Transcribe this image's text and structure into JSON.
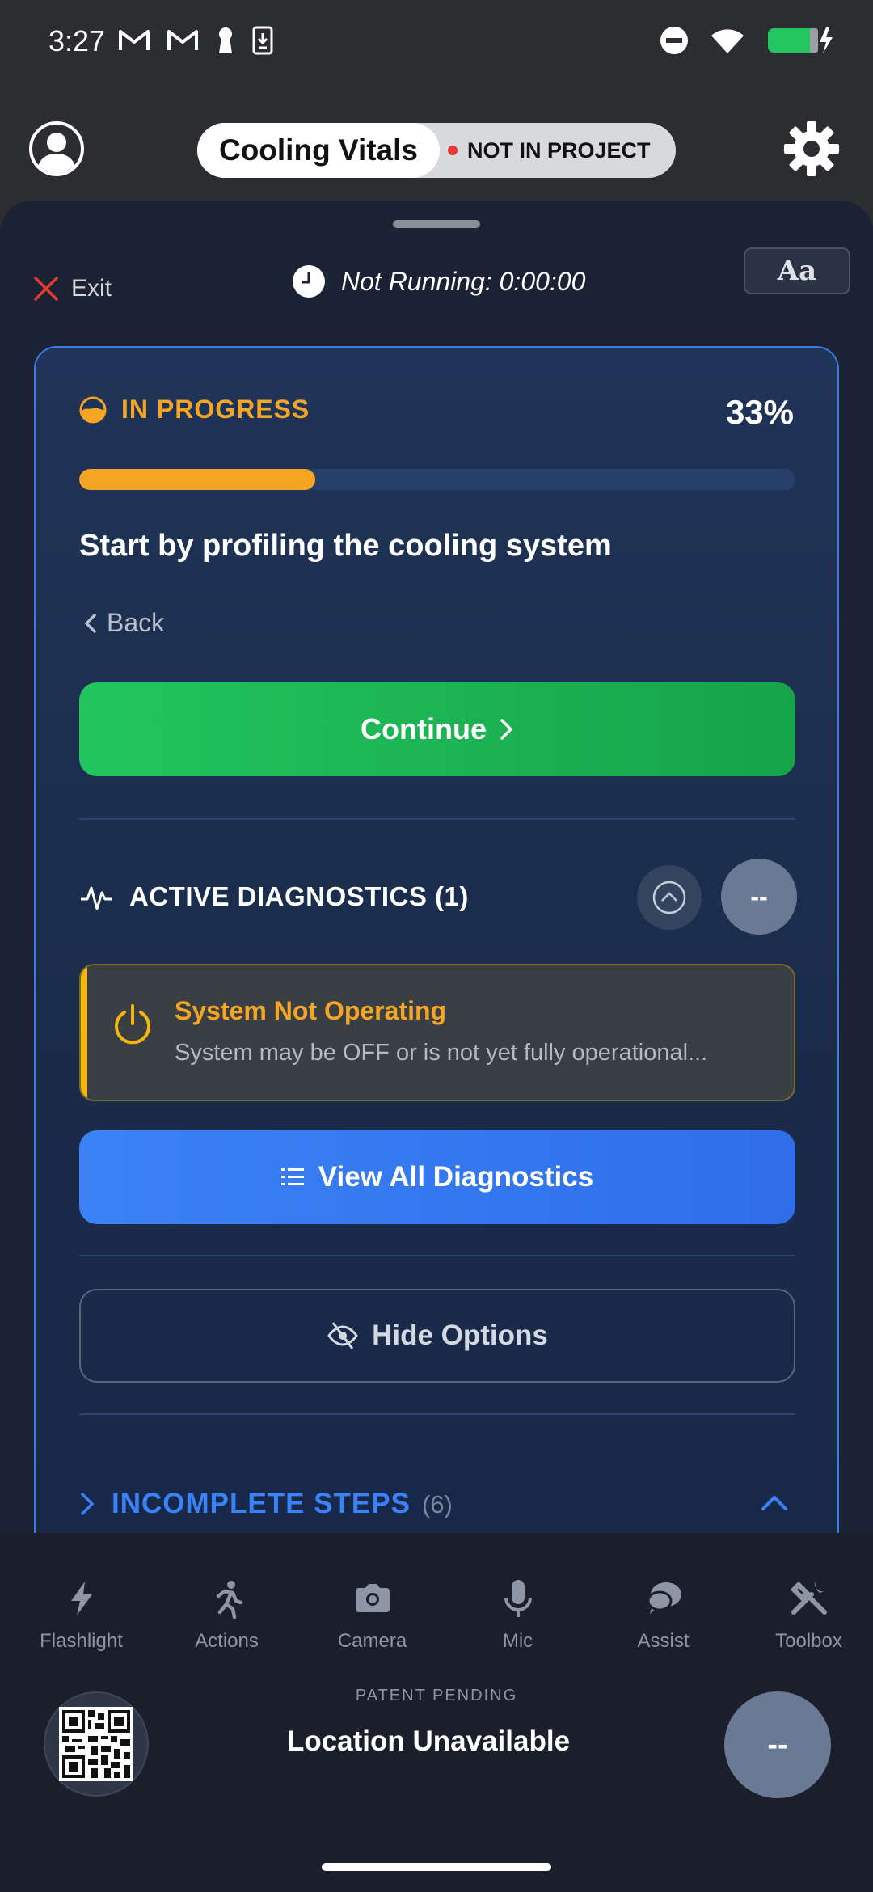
{
  "status_bar": {
    "time": "3:27"
  },
  "header": {
    "title": "Cooling Vitals",
    "project_status": "NOT IN PROJECT"
  },
  "sheet": {
    "exit_label": "Exit",
    "timer_text": "Not Running: 0:00:00",
    "font_button_label": "Aa"
  },
  "card": {
    "status_label": "IN PROGRESS",
    "percent_label": "33%",
    "progress_value": 0.33,
    "step_title": "Start by profiling the cooling system",
    "back_label": "Back",
    "continue_label": "Continue"
  },
  "diagnostics": {
    "label": "ACTIVE DIAGNOSTICS (1)",
    "badge": "--",
    "alert_title": "System Not Operating",
    "alert_text": "System may be OFF or is not yet fully operational...",
    "view_all_label": "View All Diagnostics"
  },
  "options": {
    "hide_label": "Hide Options"
  },
  "incomplete": {
    "label": "INCOMPLETE STEPS",
    "count": "(6)"
  },
  "bottom_nav": {
    "tabs": [
      {
        "label": "Flashlight",
        "icon": "flashlight-icon"
      },
      {
        "label": "Actions",
        "icon": "running-person-icon"
      },
      {
        "label": "Camera",
        "icon": "camera-icon"
      },
      {
        "label": "Mic",
        "icon": "microphone-icon"
      },
      {
        "label": "Assist",
        "icon": "chat-bubble-icon"
      },
      {
        "label": "Toolbox",
        "icon": "tools-icon"
      }
    ],
    "patent": "PATENT PENDING",
    "location": "Location Unavailable",
    "badge": "--"
  },
  "colors": {
    "accent_orange": "#f5a524",
    "accent_green": "#22c55e",
    "accent_blue": "#3b82f6",
    "sheet_bg": "#1b2233"
  }
}
